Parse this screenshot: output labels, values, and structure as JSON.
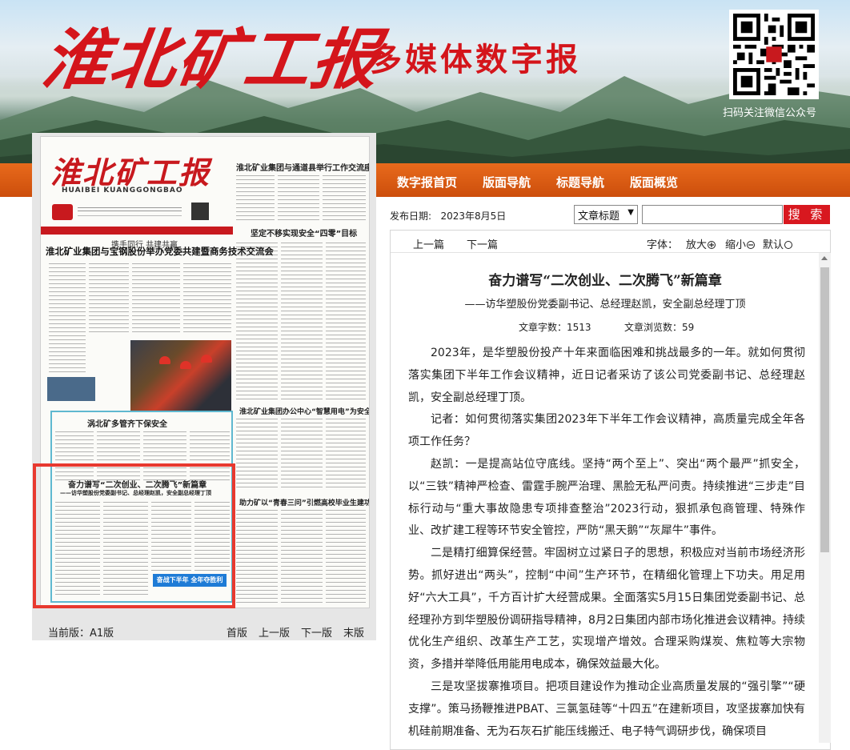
{
  "header": {
    "masthead": "淮北矿工报",
    "subtitle": "多媒体数字报",
    "qr_label": "扫码关注微信公众号"
  },
  "nav": {
    "items": [
      "数字报首页",
      "版面导航",
      "标题导航",
      "版面概览"
    ]
  },
  "newspaper": {
    "masthead": "淮北矿工报",
    "masthead_en": "HUAIBEI KUANGGONGBAO",
    "kicker": "携手同行 共建共赢",
    "headline": "淮北矿业集团与宝钢股份举办党委共建暨商务技术交流会",
    "right_title_1": "淮北矿业集团与通道县举行工作交流座谈会",
    "right_title_2": "坚定不移实现安全“四零”目标",
    "right_title_3": "淮北矿业集团办公中心“智慧用电”为安全护航",
    "right_title_4": "助力矿以“青春三问”引燃高校毕业生建功立业热情",
    "box_title": "涡北矿多管齐下保安全",
    "article_title": "奋力谱写“二次创业、二次腾飞”新篇章",
    "article_sub": "——访华塑股份党委副书记、总经理赵凯，安全副总经理丁顶",
    "banner_text": "奋战下半年  全年夺胜利"
  },
  "pagination": {
    "current": "当前版：A1版",
    "links": [
      "首版",
      "上一版",
      "下一版",
      "末版"
    ]
  },
  "toolbar": {
    "date": "发布日期:   2023年8月5日",
    "select_value": "文章标题",
    "search_label": "搜 索"
  },
  "article_toolbar": {
    "prev": "上一篇",
    "next": "下一篇",
    "font_label": "字体：",
    "zoom_in": "放大",
    "zoom_out": "缩小",
    "default": "默认"
  },
  "article": {
    "title": "奋力谱写“二次创业、二次腾飞”新篇章",
    "subtitle": "——访华塑股份党委副书记、总经理赵凯，安全副总经理丁顶",
    "word_count": "文章字数：1513",
    "view_count": "文章浏览数：59",
    "paragraphs": [
      "2023年，是华塑股份投产十年来面临困难和挑战最多的一年。就如何贯彻落实集团下半年工作会议精神，近日记者采访了该公司党委副书记、总经理赵凯，安全副总经理丁顶。",
      "记者：如何贯彻落实集团2023年下半年工作会议精神，高质量完成全年各项工作任务？",
      "赵凯：一是提高站位守底线。坚持“两个至上”、突出“两个最严”抓安全，以“三铁”精神严检查、雷霆手腕严治理、黑脸无私严问责。持续推进“三步走”目标行动与“重大事故隐患专项排查整治”2023行动，狠抓承包商管理、特殊作业、改扩建工程等环节安全管控，严防“黑天鹅”“灰犀牛”事件。",
      "二是精打细算保经营。牢固树立过紧日子的思想，积极应对当前市场经济形势。抓好进出“两头”，控制“中间”生产环节，在精细化管理上下功夫。用足用好“六大工具”，千方百计扩大经营成果。全面落实5月15日集团党委副书记、总经理孙方到华塑股份调研指导精神，8月2日集团内部市场化推进会议精神。持续优化生产组织、改革生产工艺，实现增产增效。合理采购煤炭、焦粒等大宗物资，多措并举降低用能用电成本，确保效益最大化。",
      "三是攻坚拔寨推项目。把项目建设作为推动企业高质量发展的“强引擎”“硬支撑”。策马扬鞭推进PBAT、三氯氢硅等“十四五”在建新项目，攻坚拔寨加快有机硅前期准备、无为石灰石扩能压线搬迁、电子特气调研步伐，确保项目"
    ]
  }
}
